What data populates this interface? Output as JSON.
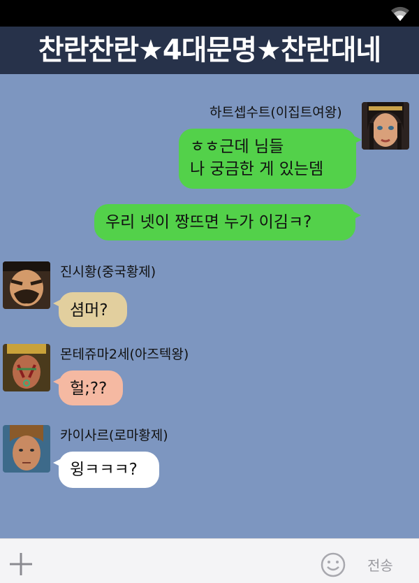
{
  "header": {
    "title": "찬란찬란★4대문명★찬란대네"
  },
  "messages": [
    {
      "sender": "하트셉수트(이집트여왕)",
      "lines": [
        "ㅎㅎ근데 님들",
        "나 궁금한 게 있는뎀"
      ],
      "second": "우리 넷이 짱뜨면 누가 이김ㅋ?"
    },
    {
      "sender": "진시황(중국황제)",
      "text": "셤머?",
      "color": "#e2cf9e"
    },
    {
      "sender": "몬테쥬마2세(아즈텍왕)",
      "text": "헐;??",
      "color": "#f5b9a2"
    },
    {
      "sender": "카이사르(로마황제)",
      "text": "윙ㅋㅋㅋ?",
      "color": "#ffffff"
    }
  ],
  "input_bar": {
    "send_label": "전송",
    "plus_icon": "plus-icon",
    "emoji_icon": "smiley-icon"
  },
  "colors": {
    "chat_bg": "#7d96c0",
    "title_bg": "#27324a",
    "my_bubble": "#53d14a"
  }
}
